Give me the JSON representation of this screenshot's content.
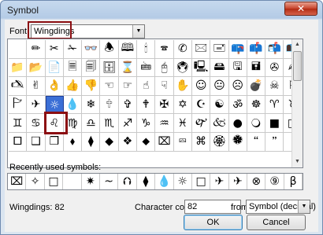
{
  "window": {
    "title": "Symbol",
    "close_glyph": "✕"
  },
  "font": {
    "label": "Font:",
    "value": "Wingdings"
  },
  "symbols": [
    "",
    "✏",
    "✂",
    "✁",
    "👓",
    "🕭",
    "🕮",
    "🕯",
    "🕿",
    "✆",
    "🖂",
    "🖃",
    "📪",
    "📫",
    "📬",
    "📭",
    "📁",
    "📂",
    "📄",
    "🗏",
    "🗐",
    "🗄",
    "⌛",
    "🖮",
    "🖰",
    "🖲",
    "🖳",
    "🖴",
    "🖫",
    "🖬",
    "✇",
    "✍",
    "🖎",
    "✌",
    "👌",
    "👍",
    "👎",
    "☜",
    "☞",
    "☝",
    "☟",
    "✋",
    "☺",
    "😐",
    "☹",
    "💣",
    "☠",
    "⚐",
    "🏱",
    "✈",
    "☼",
    "💧",
    "❄",
    "🕆",
    "✞",
    "🕈",
    "✠",
    "✡",
    "☪",
    "☯",
    "ॐ",
    "☸",
    "♈",
    "♉",
    "♊",
    "♋",
    "♌",
    "♍",
    "♎",
    "♏",
    "♐",
    "♑",
    "♒",
    "♓",
    "🙰",
    "🙵",
    "●",
    "🔾",
    "■",
    "□",
    "🞐",
    "❑",
    "❒",
    "⬧",
    "⧫",
    "◆",
    "❖",
    "⬥",
    "⌧",
    "⮹",
    "⌘",
    "🏵",
    "🏶",
    "🙶",
    "🙷",
    ""
  ],
  "selected_index": 50,
  "recent": {
    "label": "Recently used symbols:",
    "items": [
      "⌧",
      "✧",
      "□",
      "",
      "✷",
      "~",
      "⮉",
      "⧫",
      "💧",
      "☼",
      "□",
      "✈",
      "✈",
      "⊗",
      "⑨",
      "β"
    ]
  },
  "status": {
    "name": "Wingdings: 82",
    "code_label": "Character code:",
    "code_value": "82",
    "from_label": "from:",
    "from_value": "Symbol (decimal)"
  },
  "buttons": {
    "ok": "OK",
    "cancel": "Cancel"
  }
}
